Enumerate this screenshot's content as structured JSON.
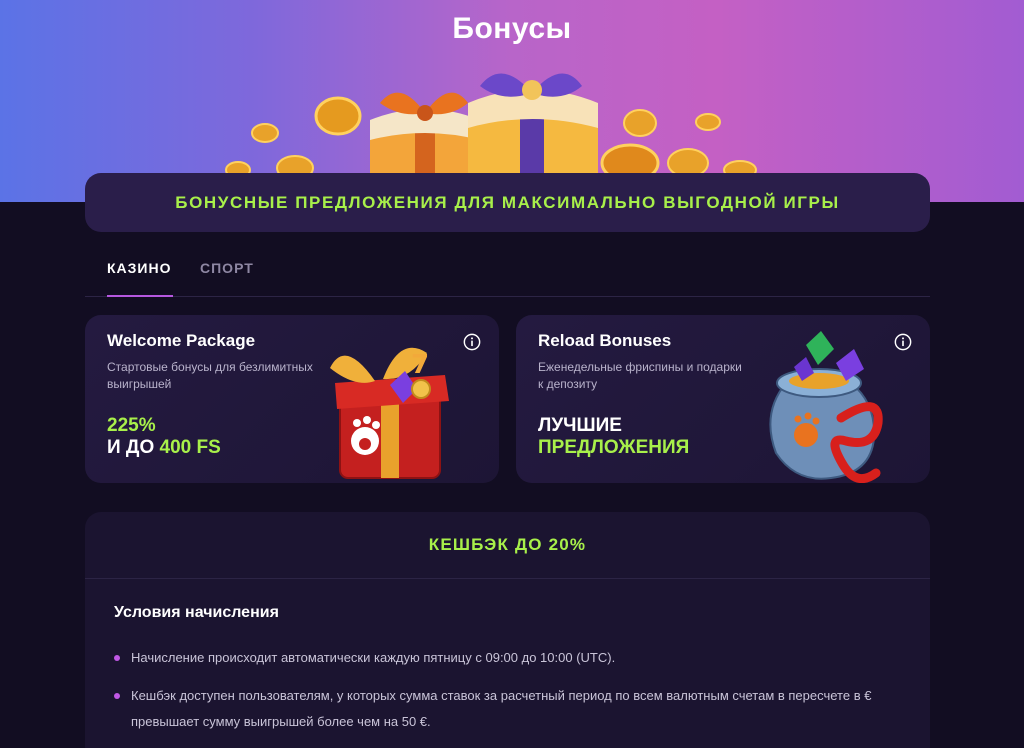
{
  "hero": {
    "title": "Бонусы"
  },
  "banner": {
    "text": "БОНУСНЫЕ ПРЕДЛОЖЕНИЯ ДЛЯ МАКСИМАЛЬНО ВЫГОДНОЙ ИГРЫ"
  },
  "tabs": [
    {
      "label": "КАЗИНО",
      "active": true
    },
    {
      "label": "СПОРТ",
      "active": false
    }
  ],
  "cards": [
    {
      "title": "Welcome Package",
      "description": "Стартовые бонусы для безлимитных выигрышей",
      "line1": "225%",
      "line2_prefix": "И ДО ",
      "line2_value": "400 FS",
      "icon": "gift-box-icon"
    },
    {
      "title": "Reload Bonuses",
      "description": "Еженедельные фриспины и подарки к депозиту",
      "line1": "ЛУЧШИЕ",
      "line2_value": "ПРЕДЛОЖЕНИЯ",
      "icon": "treasure-bag-icon"
    }
  ],
  "cashback": {
    "title": "КЕШБЭК ДО 20%",
    "conditions_title": "Условия начисления",
    "conditions": [
      "Начисление происходит автоматически каждую пятницу с 09:00 до 10:00 (UTC).",
      "Кешбэк доступен пользователям, у которых сумма ставок за расчетный период по всем валютным счетам в пересчете в € превышает сумму выигрышей более чем на 50 €."
    ]
  },
  "colors": {
    "accent_green": "#a8f04a",
    "accent_purple": "#b658e0",
    "background": "#120d22"
  }
}
